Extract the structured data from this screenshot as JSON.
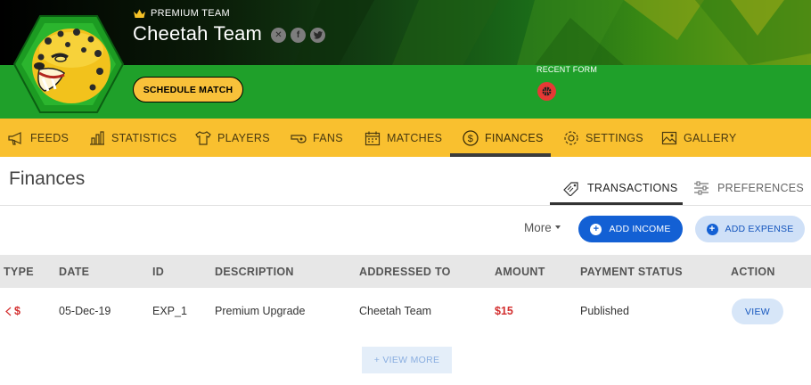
{
  "header": {
    "premium_label": "PREMIUM TEAM",
    "team_name": "Cheetah Team",
    "social_icons": [
      "xbox-icon",
      "facebook-icon",
      "twitter-icon"
    ],
    "schedule_button": "SCHEDULE MATCH",
    "recent_form_label": "RECENT FORM",
    "recent_form": [
      "loss"
    ],
    "colors": {
      "brand_green": "#1fa02a",
      "brand_yellow": "#f9c02f",
      "loss": "#e53935"
    }
  },
  "nav": {
    "items": [
      {
        "label": "FEEDS",
        "icon": "megaphone-icon"
      },
      {
        "label": "STATISTICS",
        "icon": "bar-chart-icon"
      },
      {
        "label": "PLAYERS",
        "icon": "jersey-icon"
      },
      {
        "label": "FANS",
        "icon": "whistle-icon"
      },
      {
        "label": "MATCHES",
        "icon": "calendar-icon"
      },
      {
        "label": "FINANCES",
        "icon": "dollar-coin-icon",
        "active": true
      },
      {
        "label": "SETTINGS",
        "icon": "gear-icon"
      },
      {
        "label": "GALLERY",
        "icon": "image-icon"
      }
    ]
  },
  "page": {
    "title": "Finances",
    "tabs": [
      {
        "label": "TRANSACTIONS",
        "icon": "tag-icon",
        "active": true
      },
      {
        "label": "PREFERENCES",
        "icon": "sliders-icon"
      }
    ]
  },
  "actions": {
    "more": "More",
    "add_income": "ADD INCOME",
    "add_expense": "ADD EXPENSE"
  },
  "table": {
    "columns": [
      "TYPE",
      "DATE",
      "ID",
      "DESCRIPTION",
      "ADDRESSED TO",
      "AMOUNT",
      "PAYMENT STATUS",
      "ACTION"
    ],
    "rows": [
      {
        "type": "$",
        "date": "05-Dec-19",
        "id": "EXP_1",
        "description": "Premium Upgrade",
        "addressed_to": "Cheetah Team",
        "amount": "$15",
        "status": "Published",
        "action": "VIEW"
      }
    ],
    "view_more": "+ VIEW MORE"
  }
}
